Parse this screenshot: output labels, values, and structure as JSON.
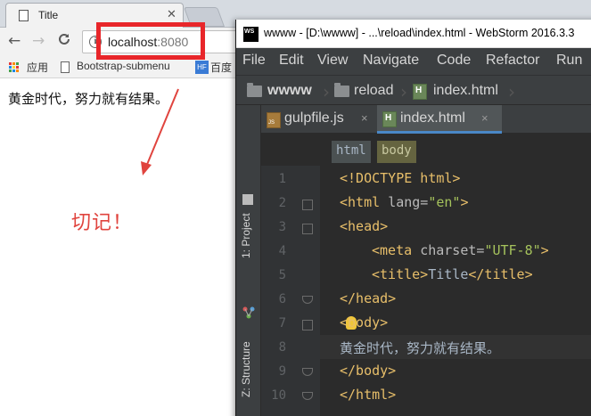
{
  "browser": {
    "tab_title": "Title",
    "tab_close": "✕",
    "nav": {
      "back": "←",
      "forward": "→",
      "reload": "C"
    },
    "url": {
      "host": "localhost",
      "port": ":8080",
      "info_icon": "i"
    },
    "bookmarks": {
      "apps": "应用",
      "bootstrap": "Bootstrap-submenu",
      "baidu": "百度",
      "baidu_badge": "HF"
    },
    "page_text": "黄金时代，努力就有结果。"
  },
  "annotation": {
    "text": "切记！",
    "color": "#e0443e"
  },
  "webstorm": {
    "window_title": "wwww - [D:\\wwww] - ...\\reload\\index.html - WebStorm 2016.3.3",
    "logo": "WS",
    "menu": [
      "File",
      "Edit",
      "View",
      "Navigate",
      "Code",
      "Refactor",
      "Run"
    ],
    "navbar": {
      "project": "wwww",
      "folder": "reload",
      "file": "index.html"
    },
    "sidebar": {
      "project": "1: Project",
      "structure": "Z: Structure"
    },
    "tabs": [
      {
        "label": "gulpfile.js",
        "close": "×"
      },
      {
        "label": "index.html",
        "close": "×"
      }
    ],
    "tag_breadcrumb": [
      "html",
      "body"
    ],
    "line_numbers": [
      "1",
      "2",
      "3",
      "4",
      "5",
      "6",
      "7",
      "8",
      "9",
      "10"
    ],
    "code": {
      "l1": "<!DOCTYPE html>",
      "l2_open": "<html ",
      "l2_attr": "lang=",
      "l2_val": "\"en\"",
      "l2_close": ">",
      "l3": "<head>",
      "l4_open": "<meta ",
      "l4_attr": "charset=",
      "l4_val": "\"UTF-8\"",
      "l4_close": ">",
      "l5_open": "<title>",
      "l5_text": "Title",
      "l5_close": "</title>",
      "l6": "</head>",
      "l7": "<body>",
      "l8": "黄金时代，努力就有结果。",
      "l9": "</body>",
      "l10": "</html>"
    },
    "colors": {
      "accent": "#4a88c7",
      "tag": "#e8bf6a",
      "string": "#a5c25c",
      "highlight_box": "#e8262a"
    }
  }
}
